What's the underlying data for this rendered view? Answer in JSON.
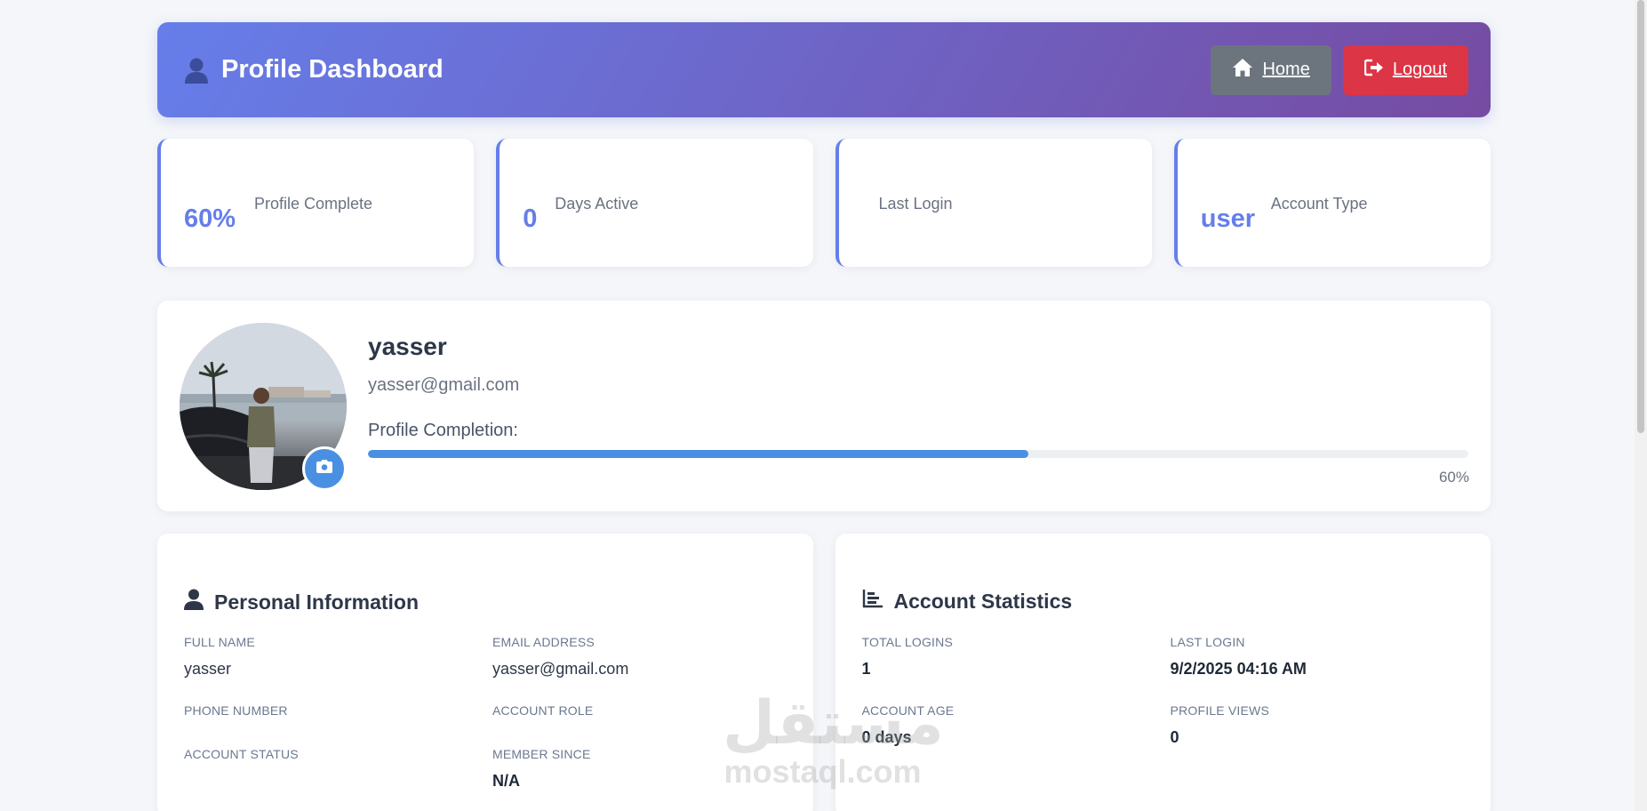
{
  "header": {
    "title": "Profile Dashboard",
    "home_label": "Home",
    "logout_label": "Logout"
  },
  "stats": [
    {
      "value": "60%",
      "label": "Profile Complete"
    },
    {
      "value": "0",
      "label": "Days Active"
    },
    {
      "value": "",
      "label": "Last Login"
    },
    {
      "value": "user",
      "label": "Account Type"
    }
  ],
  "profile": {
    "name": "yasser",
    "email": "yasser@gmail.com",
    "completion_label": "Profile Completion:",
    "completion_percent": 60,
    "completion_text": "60%"
  },
  "personal": {
    "title": "Personal Information",
    "full_name_label": "FULL NAME",
    "full_name": "yasser",
    "email_label": "EMAIL ADDRESS",
    "email": "yasser@gmail.com",
    "phone_label": "PHONE NUMBER",
    "phone": "",
    "role_label": "ACCOUNT ROLE",
    "role": "",
    "status_label": "ACCOUNT STATUS",
    "status": "",
    "member_label": "MEMBER SINCE",
    "member": "N/A"
  },
  "account_stats": {
    "title": "Account Statistics",
    "total_logins_label": "TOTAL LOGINS",
    "total_logins": "1",
    "last_login_label": "LAST LOGIN",
    "last_login": "9/2/2025 04:16 AM",
    "account_age_label": "ACCOUNT AGE",
    "account_age": "0 days",
    "profile_views_label": "PROFILE VIEWS",
    "profile_views": "0"
  },
  "watermark": {
    "arabic": "مستقل",
    "latin": "mostaql.com"
  },
  "colors": {
    "gradient_start": "#667eea",
    "gradient_end": "#764ba2",
    "home_button": "#6c757d",
    "logout_button": "#dc3545",
    "progress_fill": "#4a90e2"
  }
}
